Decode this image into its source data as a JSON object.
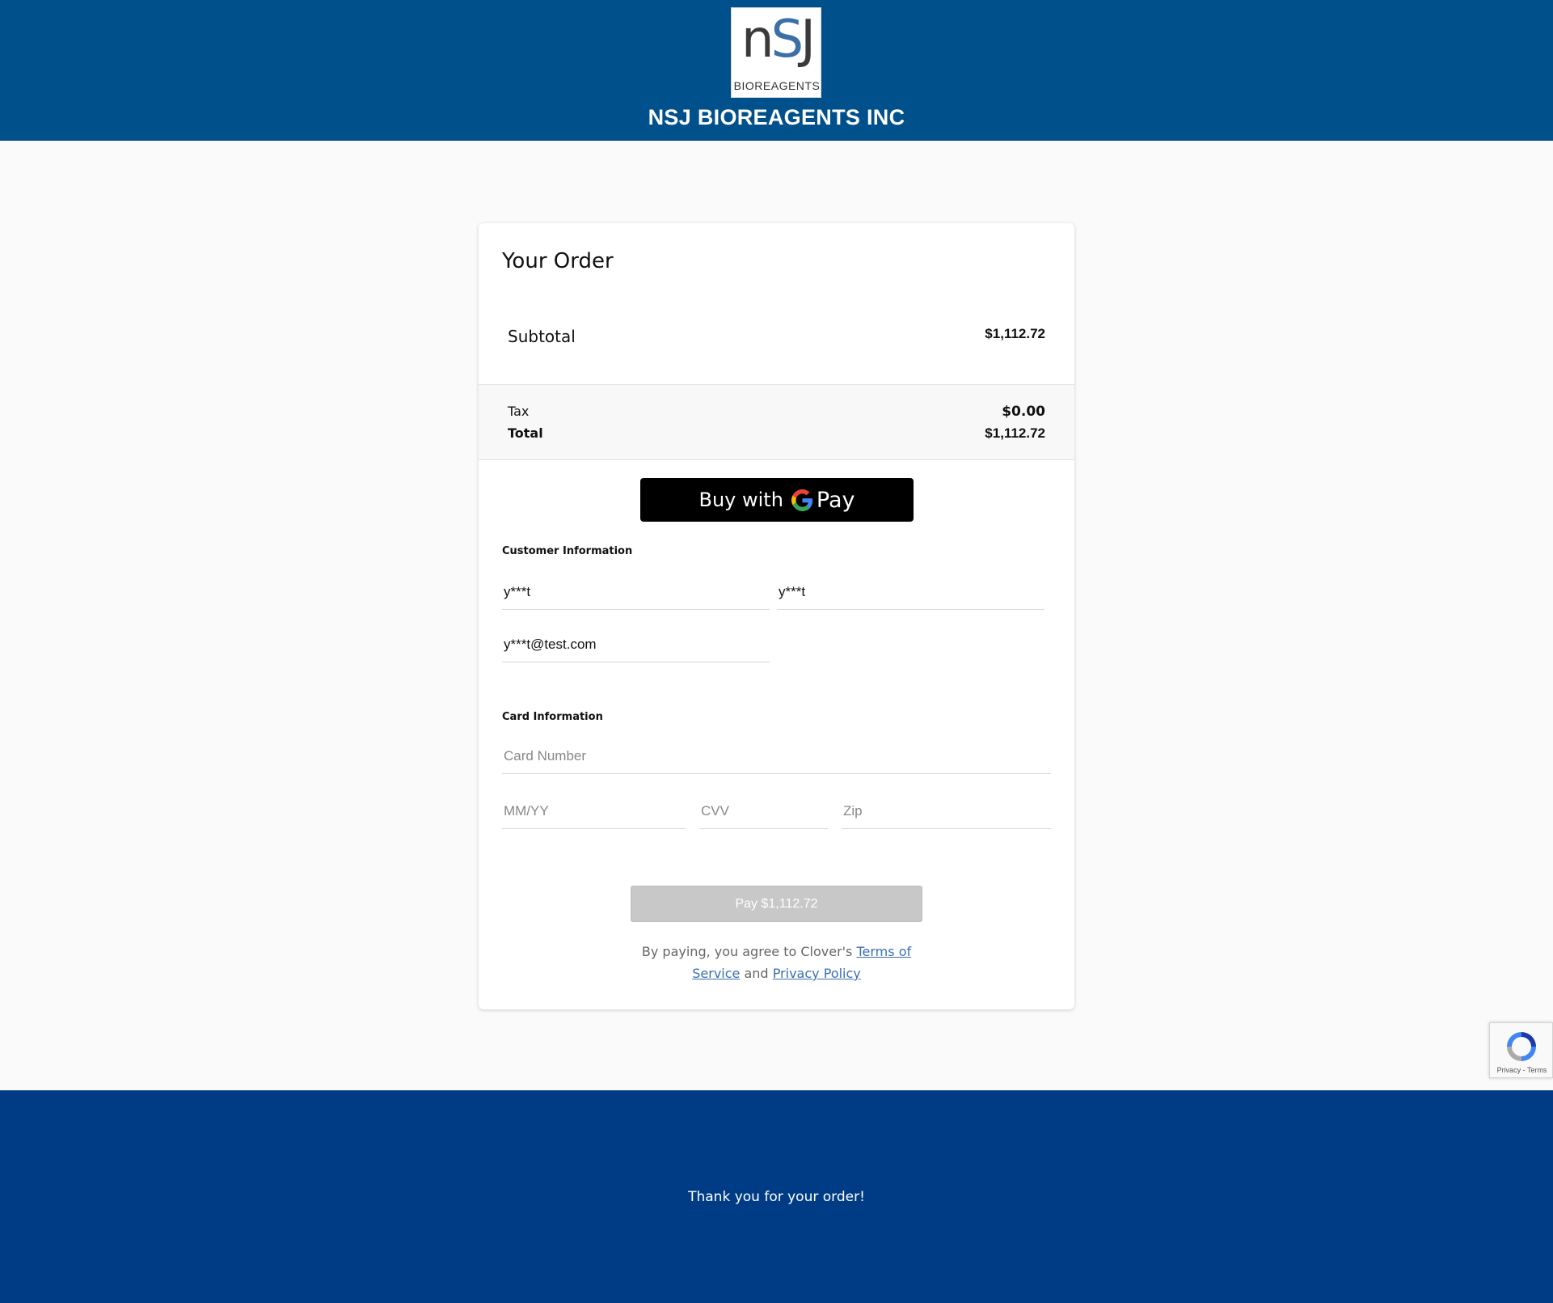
{
  "header": {
    "logo_text": "NSJ",
    "logo_subtext": "BIOREAGENTS",
    "company_name": "NSJ BIOREAGENTS INC",
    "background_color": "#00508c"
  },
  "order": {
    "title": "Your Order",
    "subtotal_label": "Subtotal",
    "subtotal_value": "$1,112.72",
    "tax_label": "Tax",
    "tax_value": "$0.00",
    "total_label": "Total",
    "total_value": "$1,112.72"
  },
  "gpay": {
    "label": "Buy with",
    "pay_word": "Pay"
  },
  "customer": {
    "section_label": "Customer Information",
    "first_name": "y***t",
    "last_name": "y***t",
    "email": "y***t@test.com"
  },
  "card": {
    "section_label": "Card Information",
    "number_placeholder": "Card Number",
    "expiry_placeholder": "MM/YY",
    "cvv_placeholder": "CVV",
    "zip_placeholder": "Zip"
  },
  "pay_button": {
    "label": "Pay $1,112.72"
  },
  "legal": {
    "prefix": "By paying, you agree to Clover's",
    "terms_link": "Terms of Service",
    "conjunction": "and",
    "privacy_link": "Privacy Policy"
  },
  "recaptcha": {
    "privacy": "Privacy",
    "separator": "-",
    "terms": "Terms"
  },
  "footer": {
    "message": "Thank you for your order!",
    "background_color": "#003c85"
  }
}
